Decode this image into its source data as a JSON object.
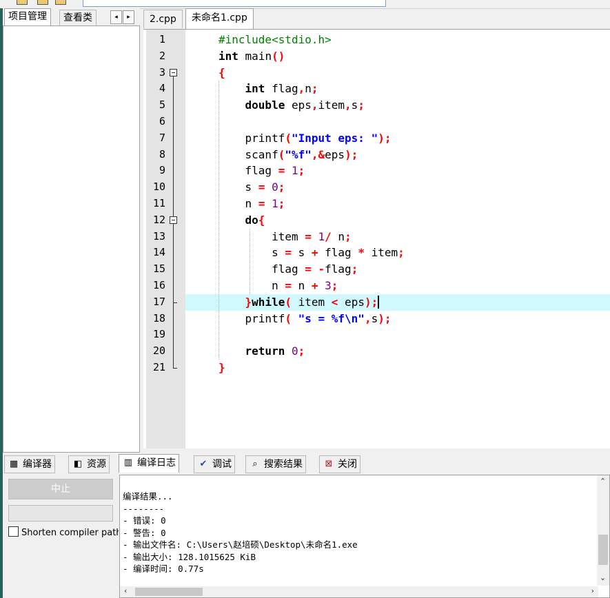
{
  "left_panel": {
    "tabs": [
      {
        "label": "项目管理",
        "active": true
      },
      {
        "label": "查看类",
        "active": false
      }
    ],
    "nav_left": "◂",
    "nav_right": "▸"
  },
  "editor": {
    "tabs": [
      {
        "label": "2.cpp",
        "active": false
      },
      {
        "label": "未命名1.cpp",
        "active": true
      }
    ],
    "highlighted_line": 17,
    "line_numbers": [
      "1",
      "2",
      "3",
      "4",
      "5",
      "6",
      "7",
      "8",
      "9",
      "10",
      "11",
      "12",
      "13",
      "14",
      "15",
      "16",
      "17",
      "18",
      "19",
      "20",
      "21"
    ],
    "code_lines": [
      "#include<stdio.h>",
      "int main()",
      "{",
      "    int flag,n;",
      "    double eps,item,s;",
      "",
      "    printf(\"Input eps: \");",
      "    scanf(\"%f\",&eps);",
      "    flag = 1;",
      "    s = 0;",
      "    n = 1;",
      "    do{",
      "        item = 1/ n;",
      "        s = s + flag * item;",
      "        flag = -flag;",
      "        n = n + 3;",
      "    }while( item < eps);",
      "    printf( \"s = %f\\n\",s);",
      "",
      "    return 0;",
      "}"
    ]
  },
  "bottom_tabs": [
    {
      "label": "编译器",
      "icon": "compiler-grid-icon",
      "active": false
    },
    {
      "label": "资源",
      "icon": "resources-icon",
      "active": false
    },
    {
      "label": "编译日志",
      "icon": "bar-chart-icon",
      "active": true
    },
    {
      "label": "调试",
      "icon": "checkmark-icon",
      "active": false
    },
    {
      "label": "搜索结果",
      "icon": "magnifier-icon",
      "active": false
    },
    {
      "label": "关闭",
      "icon": "close-panel-icon",
      "active": false
    }
  ],
  "bottom_left": {
    "stop_label": "中止",
    "shorten_label": "Shorten compiler paths",
    "shorten_checked": false
  },
  "compile_log": {
    "lines": [
      "编译结果...",
      "--------",
      "- 错误: 0",
      "- 警告: 0",
      "- 输出文件名: C:\\Users\\赵培硕\\Desktop\\未命名1.exe",
      "- 输出大小: 128.1015625 KiB",
      "- 编译时间: 0.77s"
    ]
  },
  "colors": {
    "keyword": "#000000",
    "preprocessor": "#008000",
    "operator": "#ff0000",
    "number": "#800080",
    "string": "#0000ff",
    "highlight": "#cff9ff"
  }
}
